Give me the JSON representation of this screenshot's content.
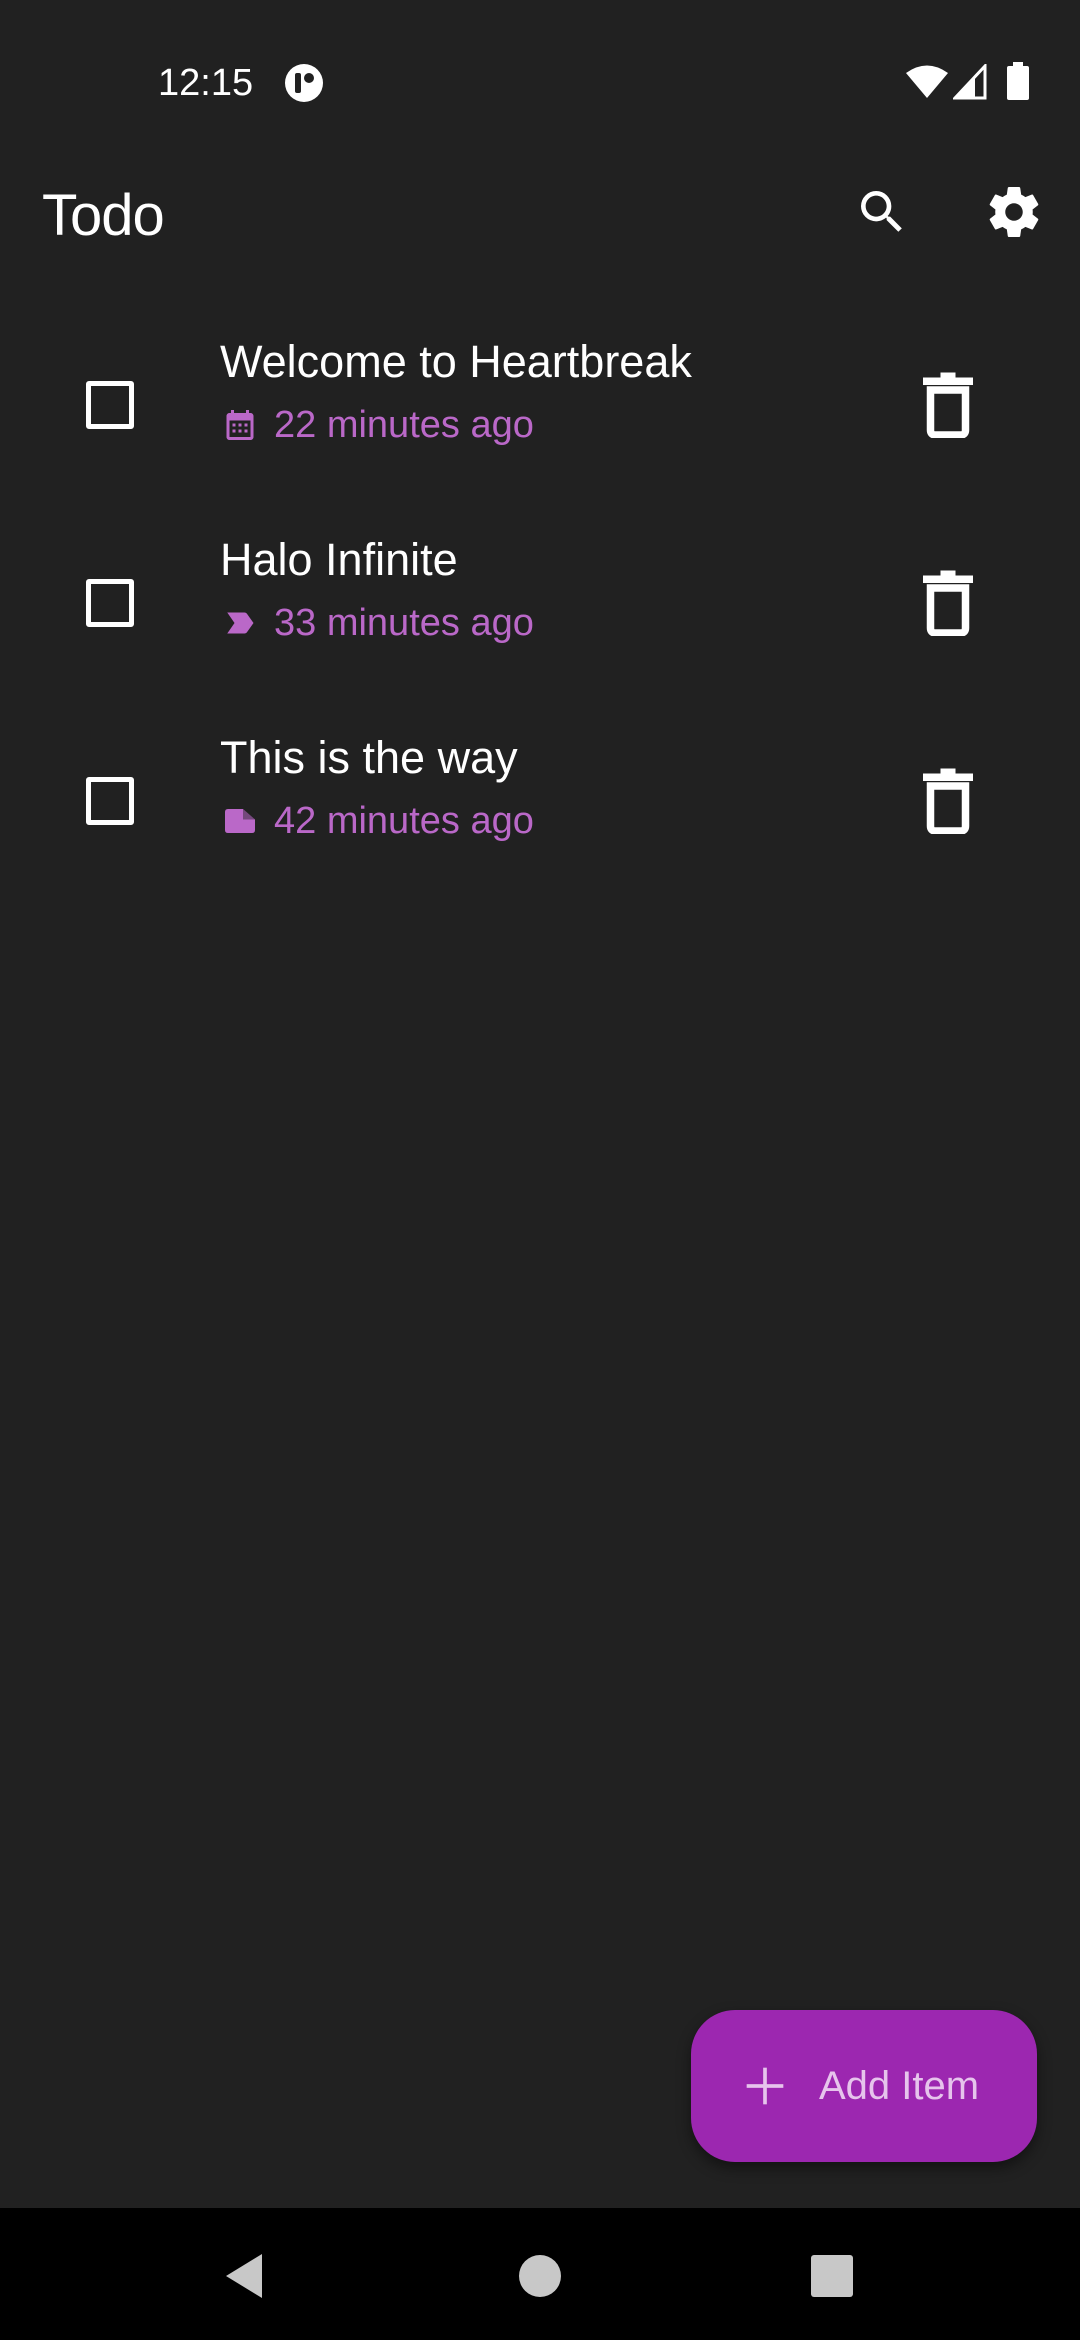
{
  "status_bar": {
    "time": "12:15",
    "icons": [
      "app-notification-icon",
      "wifi-icon",
      "cell-signal-icon",
      "battery-icon"
    ]
  },
  "app_bar": {
    "title": "Todo",
    "actions": [
      "search-icon",
      "gear-icon"
    ]
  },
  "todos": [
    {
      "title": "Welcome to Heartbreak",
      "time": "22 minutes ago",
      "meta_icon": "calendar-icon",
      "checked": false
    },
    {
      "title": "Halo Infinite",
      "time": "33 minutes ago",
      "meta_icon": "label-icon",
      "checked": false
    },
    {
      "title": "This is the way",
      "time": "42 minutes ago",
      "meta_icon": "note-icon",
      "checked": false
    }
  ],
  "fab": {
    "label": "Add Item",
    "icon": "plus-icon"
  },
  "nav_bar": {
    "icons": [
      "back-icon",
      "home-icon",
      "recents-icon"
    ]
  },
  "colors": {
    "background": "#212121",
    "accent": "#9c27b0",
    "accent_text": "#ba68c8",
    "fab_text": "#e6c4ec",
    "nav_background": "#000000"
  }
}
